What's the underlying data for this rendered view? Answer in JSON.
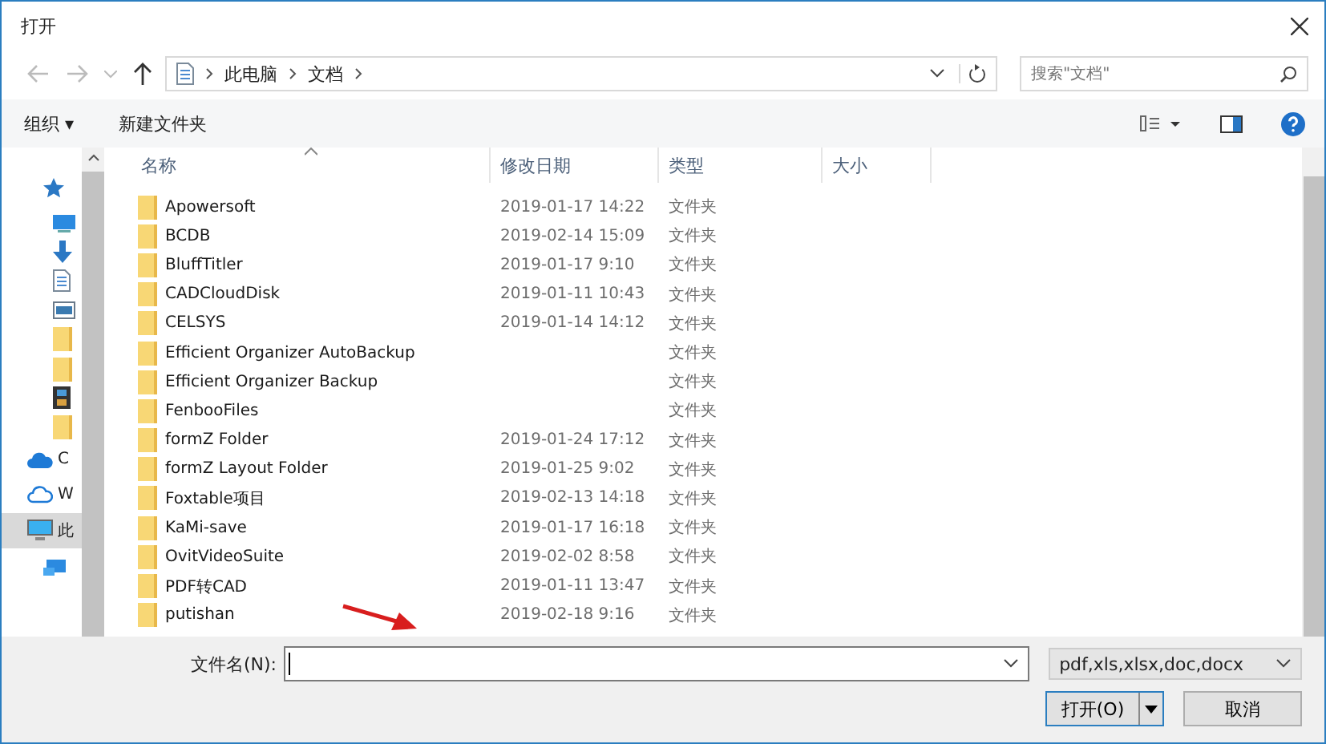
{
  "window": {
    "title": "打开"
  },
  "address_bar": {
    "path": [
      "此电脑",
      "文档"
    ]
  },
  "search": {
    "placeholder": "搜索\"文档\""
  },
  "toolbar": {
    "organize": "组织 ▾",
    "new_folder": "新建文件夹"
  },
  "sidebar": {
    "items": [
      {
        "kind": "star",
        "selected": false
      },
      {
        "kind": "desktop",
        "selected": false
      },
      {
        "kind": "download",
        "selected": false
      },
      {
        "kind": "document",
        "selected": false
      },
      {
        "kind": "image",
        "selected": false
      },
      {
        "kind": "folder",
        "selected": false
      },
      {
        "kind": "folder",
        "selected": false
      },
      {
        "kind": "video",
        "selected": false
      },
      {
        "kind": "folder",
        "selected": false
      },
      {
        "kind": "cloud",
        "label": "C",
        "selected": false
      },
      {
        "kind": "cloud-outline",
        "label": "W",
        "selected": false
      },
      {
        "kind": "pc",
        "label": "此",
        "selected": true
      },
      {
        "kind": "network",
        "selected": false
      }
    ]
  },
  "table": {
    "columns": [
      "名称",
      "修改日期",
      "类型",
      "大小"
    ],
    "rows": [
      {
        "name": "Apowersoft",
        "date": "2019-01-17 14:22",
        "type": "文件夹"
      },
      {
        "name": "BCDB",
        "date": "2019-02-14 15:09",
        "type": "文件夹"
      },
      {
        "name": "BluffTitler",
        "date": "2019-01-17 9:10",
        "type": "文件夹"
      },
      {
        "name": "CADCloudDisk",
        "date": "2019-01-11 10:43",
        "type": "文件夹"
      },
      {
        "name": "CELSYS",
        "date": "2019-01-14 14:12",
        "type": "文件夹"
      },
      {
        "name": "Efficient Organizer AutoBackup",
        "type": "文件夹"
      },
      {
        "name": "Efficient Organizer Backup",
        "type": "文件夹"
      },
      {
        "name": "FenbooFiles",
        "type": "文件夹"
      },
      {
        "name": "formZ Folder",
        "date": "2019-01-24 17:12",
        "type": "文件夹"
      },
      {
        "name": "formZ Layout Folder",
        "date": "2019-01-25 9:02",
        "type": "文件夹"
      },
      {
        "name": "Foxtable项目",
        "date": "2019-02-13 14:18",
        "type": "文件夹"
      },
      {
        "name": "KaMi-save",
        "date": "2019-01-17 16:18",
        "type": "文件夹"
      },
      {
        "name": "OvitVideoSuite",
        "date": "2019-02-02 8:58",
        "type": "文件夹"
      },
      {
        "name": "PDF转CAD",
        "date": "2019-01-11 13:47",
        "type": "文件夹"
      },
      {
        "name": "putishan",
        "date": "2019-02-18 9:16",
        "type": "文件夹"
      }
    ]
  },
  "footer": {
    "filename_label": "文件名(N):",
    "filter": "pdf,xls,xlsx,doc,docx",
    "open": "打开(O)",
    "cancel": "取消"
  }
}
